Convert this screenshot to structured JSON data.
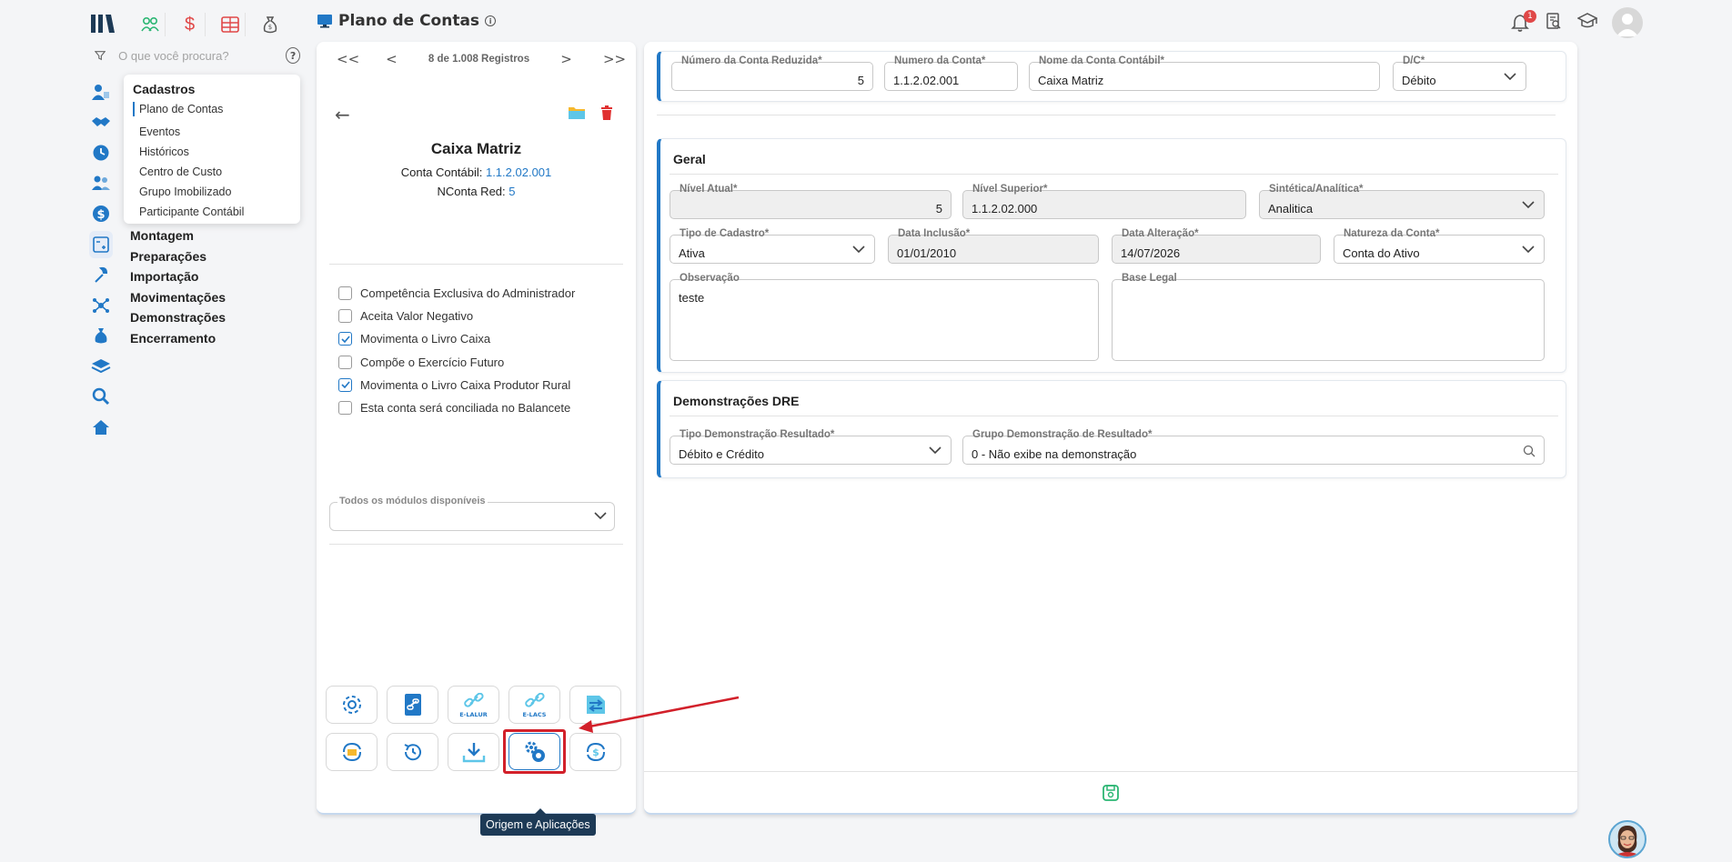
{
  "header": {
    "title": "Plano de Contas",
    "notification_count": "1"
  },
  "search": {
    "placeholder": "O que você procura?"
  },
  "cadastros_menu": {
    "title": "Cadastros",
    "items": [
      "Plano de Contas",
      "Eventos",
      "Históricos",
      "Centro de Custo",
      "Grupo Imobilizado",
      "Participante Contábil"
    ]
  },
  "side_menu": [
    "Montagem",
    "Preparações",
    "Importação",
    "Movimentações",
    "Demonstrações",
    "Encerramento"
  ],
  "pager": {
    "text": "8 de 1.008 Registros",
    "first": "<<",
    "prev": "<",
    "next": ">",
    "last": ">>"
  },
  "record": {
    "name": "Caixa Matriz",
    "conta_label": "Conta Contábil:",
    "conta_value": "1.1.2.02.001",
    "nconta_label": "NConta Red:",
    "nconta_value": "5"
  },
  "checkboxes": [
    {
      "label": "Competência Exclusiva do Administrador",
      "checked": false
    },
    {
      "label": "Aceita Valor Negativo",
      "checked": false
    },
    {
      "label": "Movimenta o Livro Caixa",
      "checked": true
    },
    {
      "label": "Compõe o Exercício Futuro",
      "checked": false
    },
    {
      "label": "Movimenta o Livro Caixa Produtor Rural",
      "checked": true
    },
    {
      "label": "Esta conta será conciliada no Balancete",
      "checked": false
    }
  ],
  "modules": {
    "label": "Todos os módulos disponíveis",
    "value": ""
  },
  "tools": {
    "elalur": "E-LALUR",
    "elacs": "E-LACS",
    "tooltip": "Origem e Aplicações"
  },
  "top_form": {
    "reduzida": {
      "label": "Número da Conta Reduzida*",
      "value": "5"
    },
    "numero": {
      "label": "Numero da Conta*",
      "value": "1.1.2.02.001"
    },
    "nome": {
      "label": "Nome da Conta Contábil*",
      "value": "Caixa Matriz"
    },
    "dc": {
      "label": "D/C*",
      "value": "Débito"
    }
  },
  "geral": {
    "title": "Geral",
    "nivel_atual": {
      "label": "Nível Atual*",
      "value": "5"
    },
    "nivel_superior": {
      "label": "Nível Superior*",
      "value": "1.1.2.02.000"
    },
    "sintetica": {
      "label": "Sintética/Analítica*",
      "value": "Analitica"
    },
    "tipo_cadastro": {
      "label": "Tipo de Cadastro*",
      "value": "Ativa"
    },
    "data_inclusao": {
      "label": "Data Inclusão*",
      "value": "01/01/2010"
    },
    "data_alteracao": {
      "label": "Data Alteração*",
      "value": "14/07/2026"
    },
    "natureza": {
      "label": "Natureza da Conta*",
      "value": "Conta do Ativo"
    },
    "observacao": {
      "label": "Observação",
      "value": "teste"
    },
    "base_legal": {
      "label": "Base Legal",
      "value": ""
    }
  },
  "dre": {
    "title": "Demonstrações DRE",
    "tipo": {
      "label": "Tipo Demonstração Resultado*",
      "value": "Débito e Crédito"
    },
    "grupo": {
      "label": "Grupo Demonstração de Resultado*",
      "value": "0 - Não exibe na demonstração"
    }
  },
  "colors": {
    "accent": "#2178c6",
    "annotation": "#d2202a",
    "tooltip_bg": "#1d3a56"
  }
}
